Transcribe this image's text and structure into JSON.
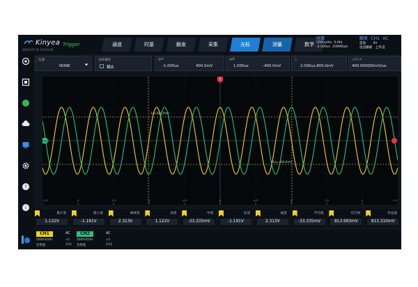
{
  "brand": {
    "name": "Kinyea",
    "datetime": "2023-07-31 15:03:35"
  },
  "header": {
    "trigger_status": "Trigger",
    "tabs": [
      {
        "label": "通道"
      },
      {
        "label": "时基"
      },
      {
        "label": "触发"
      },
      {
        "label": "采集"
      },
      {
        "label": "光标"
      },
      {
        "label": "测量"
      },
      {
        "label": "数学"
      }
    ],
    "timebase": {
      "title": "时基",
      "scale": "500ns/div",
      "position": "0.0th",
      "offset": "-2.500us",
      "sample_rate": "200MSa/s"
    },
    "trigger": {
      "title": "触发",
      "channel": "CH1",
      "coupling": "AC",
      "mode": "自动",
      "level": "0V",
      "type": "边沿触发",
      "slope": "上升沿"
    }
  },
  "params": {
    "source": {
      "label": "信源",
      "value": "NONE"
    },
    "cursor_couple": {
      "label": "光标耦合",
      "option": "耦合"
    },
    "cursor_a": {
      "label": "@A",
      "time": "-1.000us",
      "voltage": "400.0mV"
    },
    "cursor_b": {
      "label": "@B",
      "time": "1.000us",
      "voltage": "-400.0mV"
    },
    "delta": {
      "label": "△",
      "value": "2.000us,800.0mV"
    },
    "delta_rate": {
      "label": "△y/△x",
      "value": "400.000000mV/us"
    }
  },
  "graph": {
    "markers": {
      "trigger_top": "T",
      "ch_left": "CH2",
      "trigger_level": "T"
    },
    "cursor_readouts": [
      "-1us,400.0mV",
      "1us,-400.0mV"
    ],
    "time_ticks": [
      "-2.5",
      "-2",
      "-1.5",
      "-1",
      "-0.5",
      "0",
      "0.5",
      "1",
      "1.5",
      "2",
      "2.5"
    ]
  },
  "measurements": [
    {
      "label": "最大值",
      "value": "1.122V"
    },
    {
      "label": "最小值",
      "value": "-1.191V"
    },
    {
      "label": "峰峰值",
      "value": "2.313V"
    },
    {
      "label": "高值",
      "value": "1.122V"
    },
    {
      "label": "中值",
      "value": "-33.335mV"
    },
    {
      "label": "低值",
      "value": "-1.191V"
    },
    {
      "label": "幅度",
      "value": "2.313V"
    },
    {
      "label": "平均值",
      "value": "-33.335mV"
    },
    {
      "label": "均方根",
      "value": "813.993mV"
    },
    {
      "label": "标准差",
      "value": "813.310mV"
    }
  ],
  "channels": [
    {
      "name": "CH1",
      "coupling": "AC",
      "scale": "500mV/div",
      "multiplier": "×1",
      "bandwidth": "全带宽",
      "source": "CH1",
      "color": "#f0d21c"
    },
    {
      "name": "CH2",
      "coupling": "AC",
      "scale": "500mV/div",
      "multiplier": "×1",
      "bandwidth": "全带宽",
      "source": "CH2",
      "color": "#2fbe7a"
    }
  ],
  "colors": {
    "accent": "#1e7fd6",
    "ch1": "#f0d21c",
    "ch2": "#2fbe7a",
    "trigger": "#e8344a"
  },
  "left_icons": [
    "settings-icon",
    "screenshot-icon",
    "run-status-icon",
    "cloud-icon",
    "display-icon",
    "gear-icon",
    "help-icon",
    "info-icon"
  ]
}
